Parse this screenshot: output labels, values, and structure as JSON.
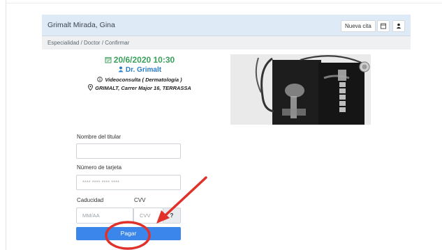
{
  "header": {
    "patient_name": "Grimalt Mirada, Gina",
    "new_appointment_label": "Nueva cita"
  },
  "breadcrumb": {
    "text": "Especialidad / Doctor / Confirmar"
  },
  "appointment": {
    "date_time": "20/6/2020 10:30",
    "doctor": "Dr. Grimalt",
    "consult_type": "Videoconsulta ( Dermatología )",
    "address": "GRIMALT, Carrer Major 16, TERRASSA"
  },
  "payment_form": {
    "holder_label": "Nombre del titular",
    "holder_value": "",
    "card_label": "Número de tarjeta",
    "card_placeholder": "**** **** **** ****",
    "expiry_label": "Caducidad",
    "expiry_placeholder": "MM/AA",
    "cvv_label": "CVV",
    "cvv_placeholder": "CVV",
    "cvv_help_label": "?",
    "pay_label": "Pagar"
  },
  "colors": {
    "date_green": "#3aa15b",
    "doctor_blue": "#2a7ec9",
    "pay_button": "#3b86ea",
    "annotation_red": "#e0312b",
    "header_bg": "#dfeaf7"
  },
  "icons": {
    "date": "calendar-icon",
    "doctor": "user-icon",
    "consult": "info-circle-icon",
    "address": "map-pin-icon"
  }
}
